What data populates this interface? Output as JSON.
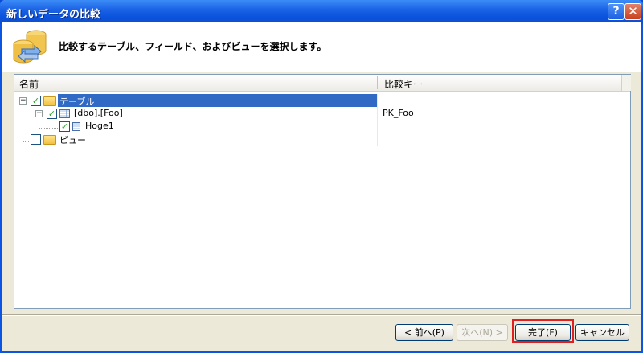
{
  "window": {
    "title": "新しいデータの比較",
    "help_symbol": "?",
    "close_symbol": "✕"
  },
  "header": {
    "instruction": "比較するテーブル、フィールド、およびビューを選択します。",
    "icon": "database-compare-icon"
  },
  "tree": {
    "columns": [
      "名前",
      "比較キー"
    ],
    "rows": [
      {
        "label": "テーブル",
        "key": "",
        "checked": true,
        "expanded": true,
        "icon": "folder-icon",
        "selected": true
      },
      {
        "label": "[dbo].[Foo]",
        "key": "PK_Foo",
        "checked": true,
        "expanded": true,
        "icon": "table-icon"
      },
      {
        "label": "Hoge1",
        "key": "",
        "checked": true,
        "icon": "column-icon"
      },
      {
        "label": "ビュー",
        "key": "",
        "checked": false,
        "icon": "folder-icon"
      }
    ]
  },
  "buttons": {
    "back": "< 前へ(P)",
    "next": "次へ(N) >",
    "finish": "完了(F)",
    "cancel": "キャンセル"
  },
  "colors": {
    "selection": "#316ac5",
    "highlight_box": "#e02020"
  }
}
